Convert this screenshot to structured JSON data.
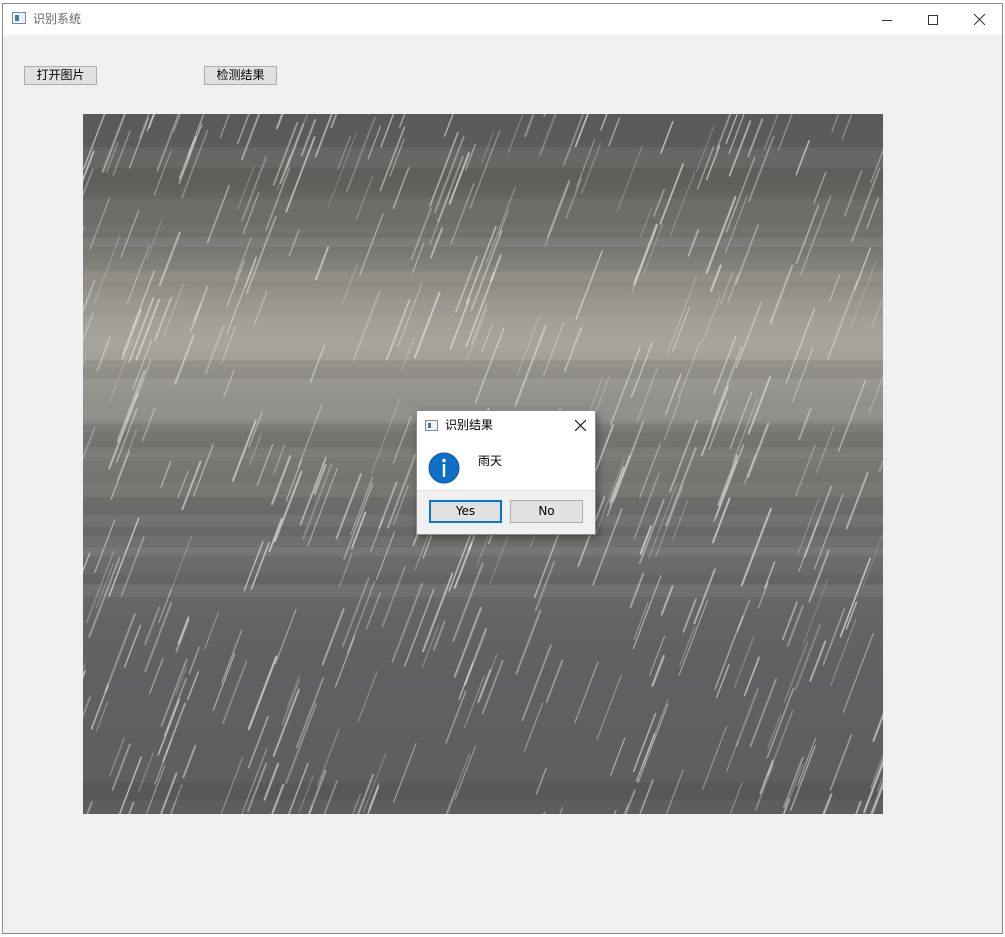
{
  "window": {
    "title": "识别系统"
  },
  "toolbar": {
    "open_image_label": "打开图片",
    "detect_result_label": "检测结果"
  },
  "image": {
    "description_icon": "rain-photo"
  },
  "dialog": {
    "title": "识别结果",
    "message": "雨天",
    "icon": "info-icon",
    "yes_label": "Yes",
    "no_label": "No",
    "accent_color": "#0078d7"
  }
}
